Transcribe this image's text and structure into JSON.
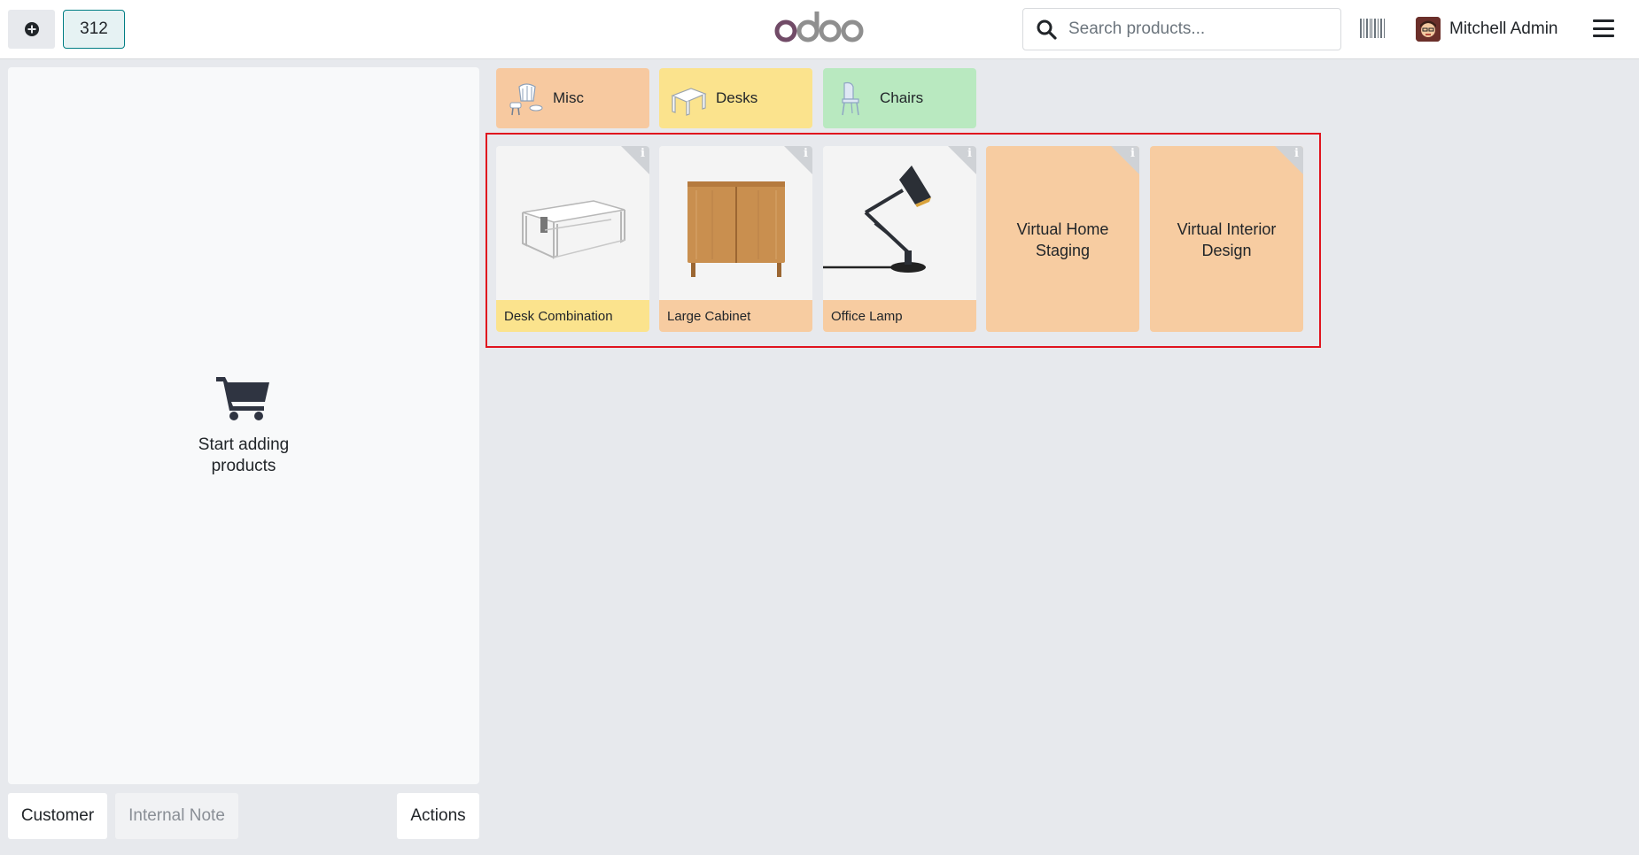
{
  "header": {
    "order_number": "312",
    "logo_text": "odoo",
    "search_placeholder": "Search products...",
    "user_name": "Mitchell Admin"
  },
  "categories": [
    {
      "label": "Misc",
      "color": "#f7c9a0"
    },
    {
      "label": "Desks",
      "color": "#fbe38d"
    },
    {
      "label": "Chairs",
      "color": "#b9e9c0"
    }
  ],
  "products": [
    {
      "name": "Desk Combination",
      "label_color": "#fbe38d",
      "image": "desk-combination"
    },
    {
      "name": "Large Cabinet",
      "label_color": "#f7cca1",
      "image": "large-cabinet"
    },
    {
      "name": "Office Lamp",
      "label_color": "#f7cca1",
      "image": "office-lamp"
    },
    {
      "name": "Virtual Home Staging",
      "color": "#f7cca1"
    },
    {
      "name": "Virtual Interior Design",
      "color": "#f7cca1"
    }
  ],
  "order": {
    "empty_message": "Start adding products"
  },
  "footer": {
    "customer_label": "Customer",
    "note_label": "Internal Note",
    "actions_label": "Actions"
  },
  "colors": {
    "brand_teal": "#017e84",
    "highlight_red": "#e0141e"
  }
}
